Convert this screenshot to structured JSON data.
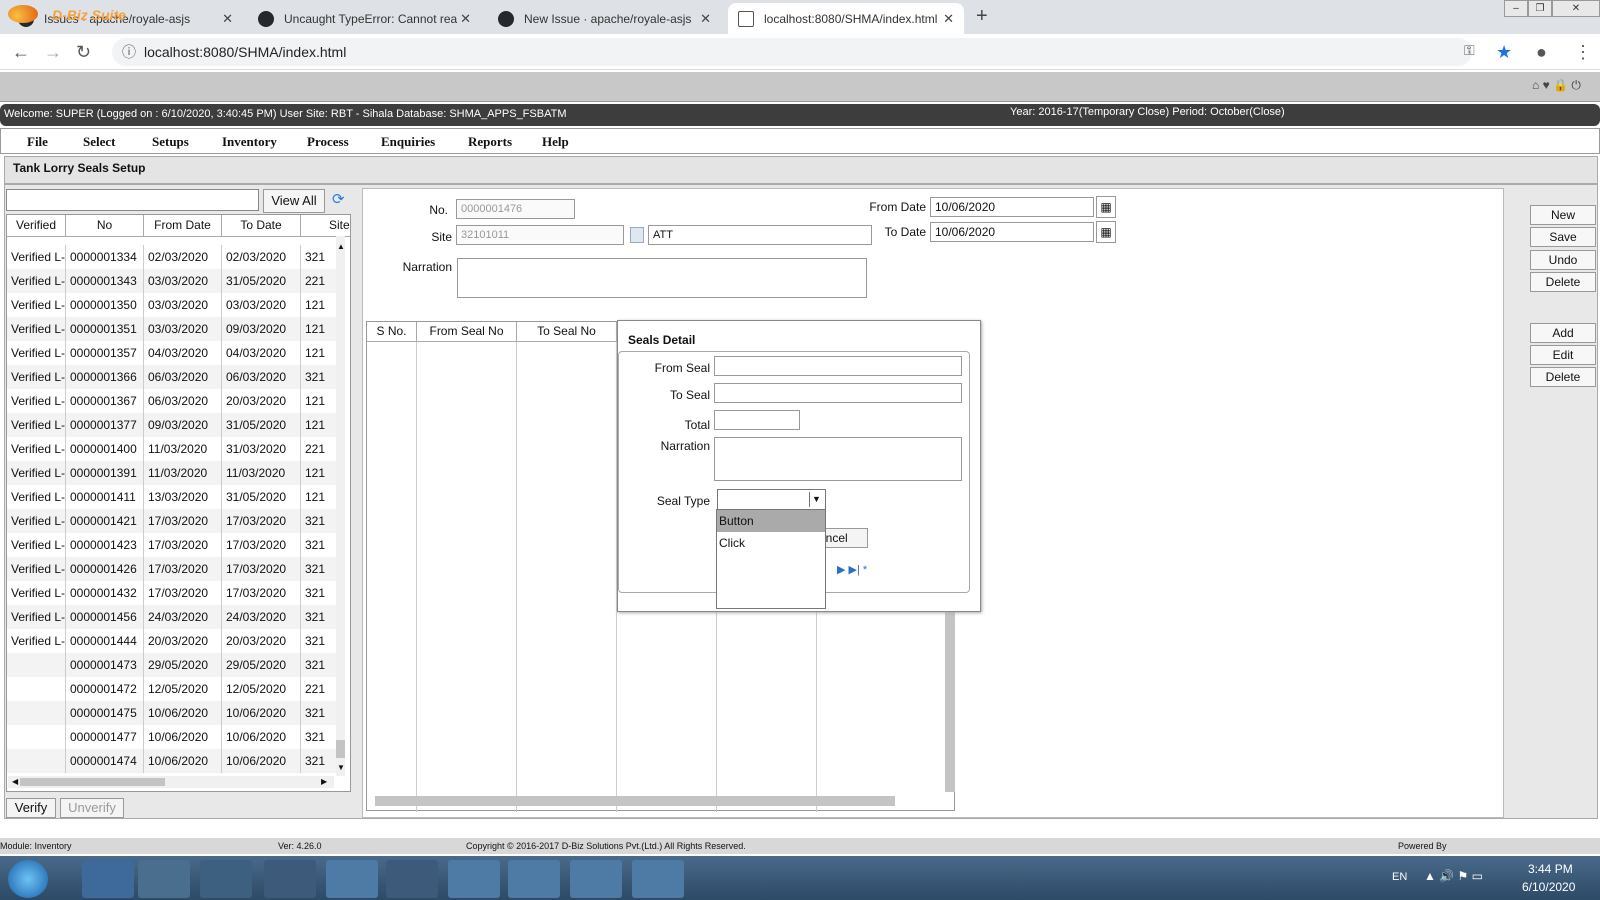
{
  "browser": {
    "tabs": [
      {
        "label": "Issues · apache/royale-asjs",
        "icon": "github-icon"
      },
      {
        "label": "Uncaught TypeError: Cannot rea",
        "icon": "github-icon"
      },
      {
        "label": "New Issue · apache/royale-asjs",
        "icon": "github-icon"
      },
      {
        "label": "localhost:8080/SHMA/index.html",
        "icon": "page-icon"
      }
    ],
    "url": "localhost:8080/SHMA/index.html"
  },
  "app": {
    "brand": "D-Biz Suite",
    "welcome": "Welcome: SUPER (Logged on : 6/10/2020, 3:40:45 PM) User Site: RBT - Sihala Database: SHMA_APPS_FSBATM",
    "year": "Year: 2016-17(Temporary Close) Period: October(Close)",
    "menu": [
      "File",
      "Select",
      "Setups",
      "Inventory",
      "Process",
      "Enquiries",
      "Reports",
      "Help"
    ],
    "page_title": "Tank Lorry Seals Setup"
  },
  "list": {
    "view_all": "View All",
    "columns": [
      "Verified",
      "No",
      "From Date",
      "To Date",
      "Site"
    ],
    "rows": [
      [
        "Verified L-",
        "0000001334",
        "02/03/2020",
        "02/03/2020",
        "321"
      ],
      [
        "Verified L-",
        "0000001343",
        "03/03/2020",
        "31/05/2020",
        "221"
      ],
      [
        "Verified L-",
        "0000001350",
        "03/03/2020",
        "03/03/2020",
        "121"
      ],
      [
        "Verified L-",
        "0000001351",
        "03/03/2020",
        "09/03/2020",
        "121"
      ],
      [
        "Verified L-",
        "0000001357",
        "04/03/2020",
        "04/03/2020",
        "121"
      ],
      [
        "Verified L-",
        "0000001366",
        "06/03/2020",
        "06/03/2020",
        "321"
      ],
      [
        "Verified L-",
        "0000001367",
        "06/03/2020",
        "20/03/2020",
        "121"
      ],
      [
        "Verified L-",
        "0000001377",
        "09/03/2020",
        "31/05/2020",
        "121"
      ],
      [
        "Verified L-",
        "0000001400",
        "11/03/2020",
        "31/03/2020",
        "221"
      ],
      [
        "Verified L-",
        "0000001391",
        "11/03/2020",
        "11/03/2020",
        "121"
      ],
      [
        "Verified L-",
        "0000001411",
        "13/03/2020",
        "31/05/2020",
        "121"
      ],
      [
        "Verified L-",
        "0000001421",
        "17/03/2020",
        "17/03/2020",
        "321"
      ],
      [
        "Verified L-",
        "0000001423",
        "17/03/2020",
        "17/03/2020",
        "321"
      ],
      [
        "Verified L-",
        "0000001426",
        "17/03/2020",
        "17/03/2020",
        "321"
      ],
      [
        "Verified L-",
        "0000001432",
        "17/03/2020",
        "17/03/2020",
        "321"
      ],
      [
        "Verified L-",
        "0000001456",
        "24/03/2020",
        "24/03/2020",
        "321"
      ],
      [
        "Verified L-",
        "0000001444",
        "20/03/2020",
        "20/03/2020",
        "321"
      ],
      [
        "",
        "0000001473",
        "29/05/2020",
        "29/05/2020",
        "321"
      ],
      [
        "",
        "0000001472",
        "12/05/2020",
        "12/05/2020",
        "221"
      ],
      [
        "",
        "0000001475",
        "10/06/2020",
        "10/06/2020",
        "321"
      ],
      [
        "",
        "0000001477",
        "10/06/2020",
        "10/06/2020",
        "321"
      ],
      [
        "",
        "0000001474",
        "10/06/2020",
        "10/06/2020",
        "321"
      ]
    ],
    "verify": "Verify",
    "unverify": "Unverify"
  },
  "form": {
    "no_label": "No.",
    "no_value": "0000001476",
    "site_label": "Site",
    "site_code": "32101011",
    "site_name": "ATT",
    "from_date_label": "From Date",
    "from_date": "10/06/2020",
    "to_date_label": "To Date",
    "to_date": "10/06/2020",
    "narration_label": "Narration",
    "detail_columns": [
      "S No.",
      "From Seal No",
      "To Seal No"
    ]
  },
  "actions": {
    "new": "New",
    "save": "Save",
    "undo": "Undo",
    "delete": "Delete",
    "add": "Add",
    "edit": "Edit",
    "delete2": "Delete"
  },
  "modal": {
    "title": "Seals Detail",
    "from_seal": "From Seal",
    "to_seal": "To Seal",
    "total": "Total",
    "narration": "Narration",
    "seal_type": "Seal Type",
    "cancel_partial": "ancel",
    "options": [
      "Button",
      "Click"
    ]
  },
  "status": {
    "module": "Module: Inventory",
    "version": "Ver: 4.26.0",
    "copyright": "Copyright © 2016-2017 D-Biz Solutions Pvt.(Ltd.) All Rights Reserved.",
    "powered": "Powered By"
  },
  "taskbar": {
    "lang": "EN",
    "time": "3:44 PM",
    "date": "6/10/2020"
  }
}
